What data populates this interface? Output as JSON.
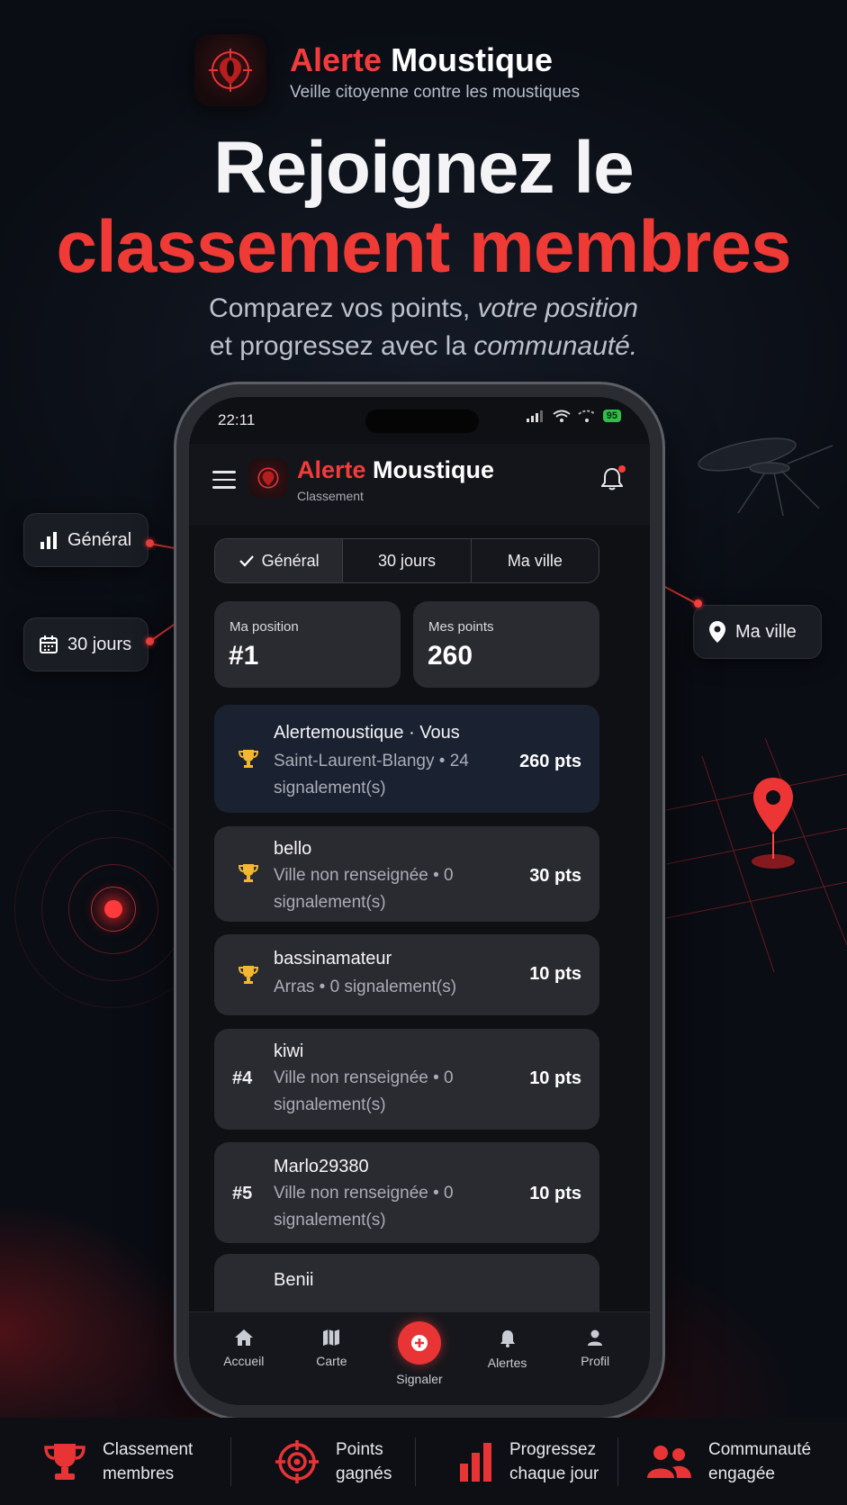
{
  "brand": {
    "name_part1": "Alerte",
    "name_part2": "Moustique",
    "tagline": "Veille citoyenne contre les moustiques",
    "accent_color": "#f23b3b"
  },
  "hero": {
    "line1": "Rejoignez le",
    "line2": "classement membres",
    "sub_line1_a": "Comparez vos points, ",
    "sub_line1_b": "votre position",
    "sub_line2_a": "et progressez avec la ",
    "sub_line2_b": "communauté."
  },
  "callouts": {
    "general": "Général",
    "days30": "30 jours",
    "city": "Ma ville"
  },
  "phone": {
    "status": {
      "time": "22:11",
      "battery": "95"
    },
    "header": {
      "title_part1": "Alerte",
      "title_part2": "Moustique",
      "subtitle": "Classement"
    },
    "tabs": [
      {
        "label": "Général",
        "active": true
      },
      {
        "label": "30 jours",
        "active": false
      },
      {
        "label": "Ma ville",
        "active": false
      }
    ],
    "stats": {
      "position_label": "Ma position",
      "position_value": "#1",
      "points_label": "Mes points",
      "points_value": "260"
    },
    "ranking": [
      {
        "rank": "",
        "trophy": true,
        "name": "Alertemoustique · Vous",
        "meta": "Saint-Laurent-Blangy • 24 signalement(s)",
        "points": "260 pts"
      },
      {
        "rank": "",
        "trophy": true,
        "name": "bello",
        "meta": "Ville non renseignée • 0 signalement(s)",
        "points": "30 pts"
      },
      {
        "rank": "",
        "trophy": true,
        "name": "bassinamateur",
        "meta": "Arras • 0 signalement(s)",
        "points": "10 pts"
      },
      {
        "rank": "#4",
        "trophy": false,
        "name": "kiwi",
        "meta": "Ville non renseignée • 0 signalement(s)",
        "points": "10 pts"
      },
      {
        "rank": "#5",
        "trophy": false,
        "name": "Marlo29380",
        "meta": "Ville non renseignée • 0 signalement(s)",
        "points": "10 pts"
      },
      {
        "rank": "",
        "trophy": false,
        "name": "Benii",
        "meta": "",
        "points": ""
      }
    ],
    "nav": [
      {
        "label": "Accueil",
        "icon": "home-icon"
      },
      {
        "label": "Carte",
        "icon": "map-icon"
      },
      {
        "label": "Signaler",
        "icon": "plus-circle-icon"
      },
      {
        "label": "Alertes",
        "icon": "bell-icon"
      },
      {
        "label": "Profil",
        "icon": "person-icon"
      }
    ]
  },
  "features": [
    {
      "line1": "Classement",
      "line2": "membres",
      "icon": "trophy-icon"
    },
    {
      "line1": "Points",
      "line2": "gagnés",
      "icon": "target-icon"
    },
    {
      "line1": "Progressez",
      "line2": "chaque jour",
      "icon": "bar-chart-icon"
    },
    {
      "line1": "Communauté",
      "line2": "engagée",
      "icon": "people-icon"
    }
  ]
}
